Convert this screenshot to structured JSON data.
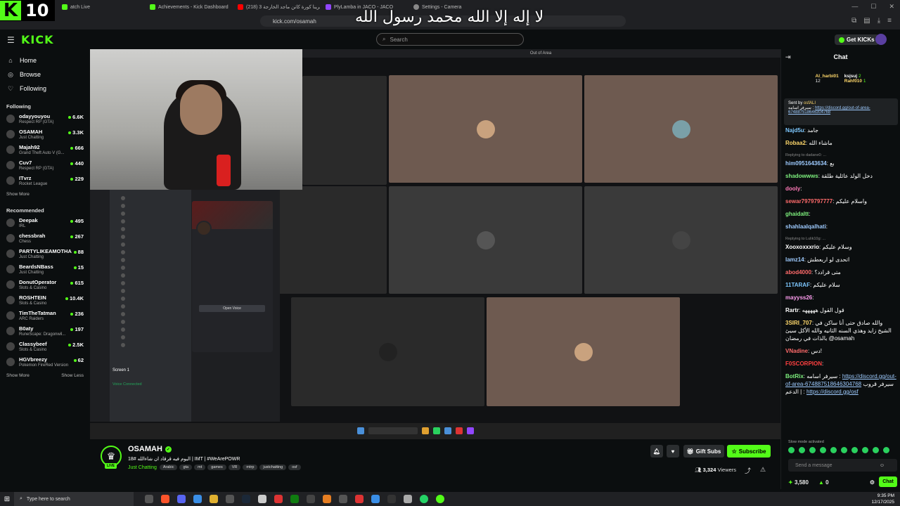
{
  "badge": {
    "k": "K",
    "num": "10"
  },
  "overlay_text": "لا إله إلا الله محمد رسول الله",
  "tabs": [
    {
      "label": "atch Live"
    },
    {
      "label": "Achievements - Kick Dashboard"
    },
    {
      "label": "(218) حرينا كورة كاتن ماجد الخارجة 3#"
    },
    {
      "label": "PlyLamba in JACO - JACO"
    },
    {
      "label": "Settings - Camera"
    }
  ],
  "address_bar": {
    "url": "kick.com/osamah"
  },
  "header": {
    "logo": "KICK",
    "search_placeholder": "Search",
    "get_kicks": "Get KICKs"
  },
  "sidebar": {
    "nav": [
      {
        "label": "Home",
        "icon": "home-icon"
      },
      {
        "label": "Browse",
        "icon": "compass-icon"
      },
      {
        "label": "Following",
        "icon": "heart-icon"
      }
    ],
    "following_title": "Following",
    "following": [
      {
        "name": "odayyouyou",
        "category": "Respect RP (GTA)",
        "viewers": "6.6K"
      },
      {
        "name": "OSAMAH",
        "category": "Just Chatting",
        "viewers": "3.3K"
      },
      {
        "name": "Majah92",
        "category": "Grand Theft Auto V (G...",
        "viewers": "666"
      },
      {
        "name": "Cuv7",
        "category": "Respect RP (GTA)",
        "viewers": "440"
      },
      {
        "name": "ITvrz",
        "category": "Rocket League",
        "viewers": "229"
      }
    ],
    "show_more_1": "Show More",
    "recommended_title": "Recommended",
    "recommended": [
      {
        "name": "Deepak",
        "category": "IRL",
        "viewers": "495"
      },
      {
        "name": "chessbrah",
        "category": "Chess",
        "viewers": "267"
      },
      {
        "name": "PARTYLIKEAMOTHA",
        "category": "Just Chatting",
        "viewers": "88"
      },
      {
        "name": "BeardsNBass",
        "category": "Just Chatting",
        "viewers": "15"
      },
      {
        "name": "DonutOperator",
        "category": "Slots & Casino",
        "viewers": "615"
      },
      {
        "name": "ROSHTEIN",
        "category": "Slots & Casino",
        "viewers": "10.4K"
      },
      {
        "name": "TimTheTatman",
        "category": "ARC Raiders",
        "viewers": "236"
      },
      {
        "name": "B0aty",
        "category": "RuneScape: Dragonwil...",
        "viewers": "197"
      },
      {
        "name": "Classybeef",
        "category": "Slots & Casino",
        "viewers": "2.5K"
      },
      {
        "name": "HGVbreezy",
        "category": "Pokemon FireRed Version",
        "viewers": "62"
      }
    ],
    "show_more_2": "Show More",
    "show_less": "Show Less"
  },
  "player": {
    "discord_window_title": "Out of Area",
    "open_voice": "Open Voice",
    "screen_label": "Screen 1",
    "voice_connected": "Voice Connected"
  },
  "stream": {
    "streamer": "OSAMAH",
    "live": "LIVE",
    "title": "اليوم فيه قرقاد ان شاءالله #18 | IMT | #WeArePOWR",
    "category": "Just Chatting",
    "tags": [
      "Arabic",
      "gta",
      "mt",
      "games",
      "VR",
      "mtrp",
      "justchatting",
      "osf"
    ],
    "gift_subs": "Gift Subs",
    "subscribe": "Subscribe",
    "viewers_count": "3,324",
    "viewers_label": "Viewers"
  },
  "chat": {
    "title": "Chat",
    "leaderboard": [
      {
        "name": "Al_harbi01",
        "score": "12"
      },
      {
        "name": "ksjsuj",
        "score": "2"
      },
      {
        "name": "Rahf010",
        "score": "1"
      }
    ],
    "pinned_by": "Sent by",
    "pinned_user": "osfALI",
    "pinned_text": "سيرفر اسامه :",
    "pinned_link": "https://discord.gg/out-of-area-674887518646304768",
    "messages": [
      {
        "user": "Najd5u",
        "color": "#7ec8ff",
        "text": "جامد"
      },
      {
        "user": "Robaa2",
        "color": "#ffd86b",
        "text": "ماشاء الله"
      },
      {
        "reply": "Replying to dadane0: ...",
        "user": "him0951643634",
        "color": "#9ecbff",
        "text": "بع"
      },
      {
        "user": "shadowwws",
        "color": "#7ef07e",
        "text": "دخل الولد عائلية طلقة"
      },
      {
        "user": "dooly",
        "color": "#ff7ab8",
        "text": ""
      },
      {
        "user": "sewar7979797777",
        "color": "#ff6b6b",
        "text": "واسلام عليكم"
      },
      {
        "user": "ghaidaltt",
        "color": "#7ef07e",
        "text": ""
      },
      {
        "user": "shahlaalqalhati",
        "color": "#9ecbff",
        "text": ""
      },
      {
        "reply": "Replying to Lulik10g: ...",
        "user": "Xooxoxxxrio",
        "color": "#ffffff",
        "text": "وسلام عليكم"
      },
      {
        "user": "lamz14",
        "color": "#9ecbff",
        "text": "اتحدى لو اربعطش"
      },
      {
        "user": "abod4000",
        "color": "#ff6b6b",
        "text": "متى قرادد؟"
      },
      {
        "user": "11TARAF",
        "color": "#7ec8ff",
        "text": "سلام عليكم"
      },
      {
        "user": "mayyss26",
        "color": "#ff9ef0",
        "text": ""
      },
      {
        "user": "Rartr",
        "color": "#ffffff",
        "text": "قول القول هههههه"
      },
      {
        "user": "3SIRI_707",
        "color": "#ffd86b",
        "text": "والله صادق حتى أنا ساكن في الشيخ زايد وهذي السنه الثانيه والله الأكل سيئ بالذات في رمضان @osamah"
      },
      {
        "user": "VNadine",
        "color": "#ff6b6b",
        "text": "دس!"
      },
      {
        "user": "F0SCORPION",
        "color": "#ff4040",
        "text": ""
      },
      {
        "user": "BotRix",
        "color": "#7ef07e",
        "text": "سيرفر اسامه :",
        "link": "https://discord.gg/out-of-area-674887518646304768",
        "text2": "سيرفر قروب | الدعم :",
        "link2": "https://discord.gg/osf"
      }
    ],
    "slow_mode": "Slow mode activated",
    "send_placeholder": "Send a message",
    "points": "3,580",
    "zero": "0",
    "chat_button": "Chat"
  },
  "taskbar": {
    "search": "Type here to search",
    "time": "9:35 PM",
    "date": "12/17/2025"
  }
}
